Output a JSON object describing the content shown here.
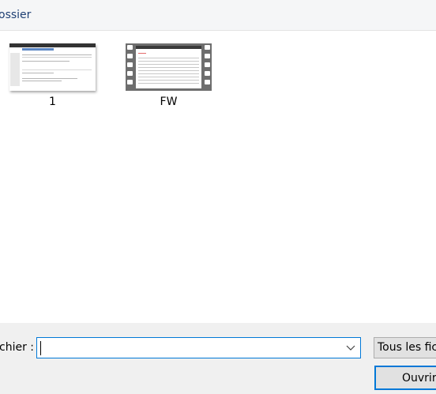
{
  "toolbar": {
    "new_folder_label": "ossier"
  },
  "files": [
    {
      "name": "1",
      "kind": "image"
    },
    {
      "name": "FW",
      "kind": "video"
    }
  ],
  "footer": {
    "filename_label": "chier :",
    "filename_value": "",
    "filetype_value": "Tous les fich",
    "open_label": "Ouvrir"
  },
  "icons": {
    "dropdown": "chevron-down-icon"
  },
  "colors": {
    "accent": "#0078d7",
    "toolbar_text": "#1e3f73",
    "footer_bg": "#f0f0f0"
  }
}
